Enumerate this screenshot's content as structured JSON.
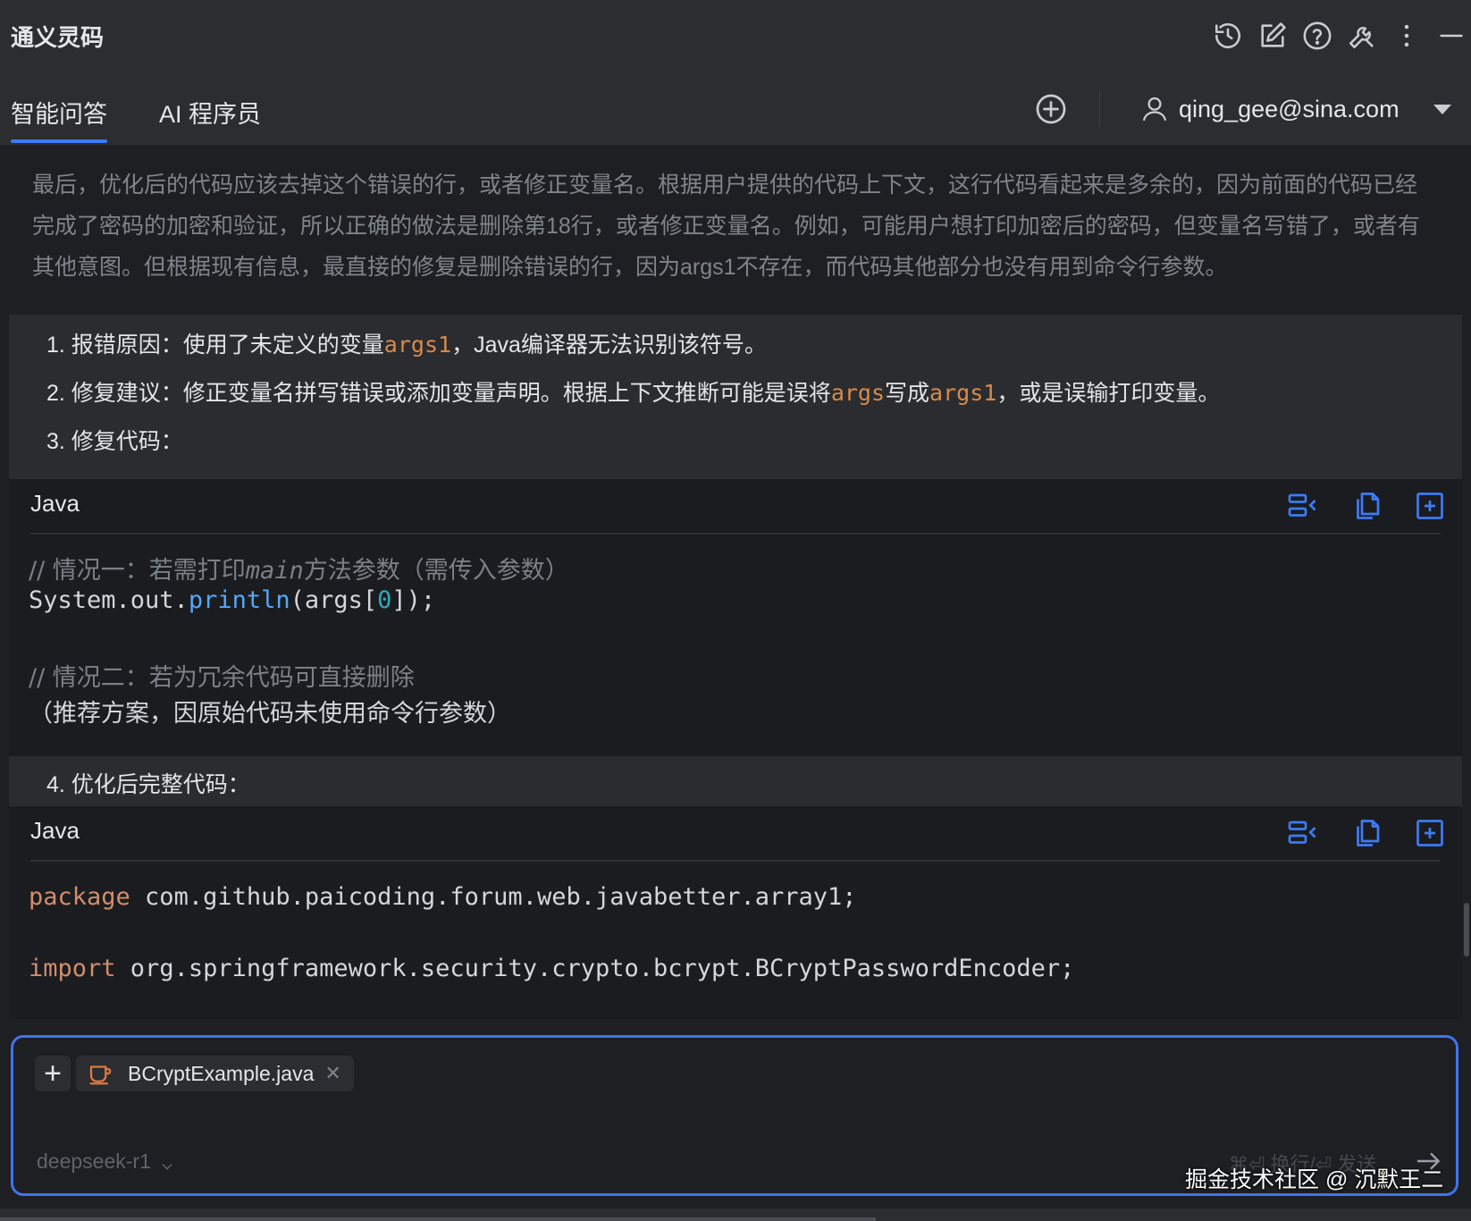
{
  "header": {
    "app_title": "通义灵码",
    "icons": [
      "history-icon",
      "edit-icon",
      "help-icon",
      "settings-wrench-icon",
      "more-vertical-icon",
      "minimize-icon"
    ]
  },
  "tabs": [
    {
      "label": "智能问答",
      "active": true
    },
    {
      "label": "AI 程序员",
      "active": false
    }
  ],
  "user": {
    "email": "qing_gee@sina.com"
  },
  "chat": {
    "reasoning_text": "最后，优化后的代码应该去掉这个错误的行，或者修正变量名。根据用户提供的代码上下文，这行代码看起来是多余的，因为前面的代码已经完成了密码的加密和验证，所以正确的做法是删除第18行，或者修正变量名。例如，可能用户想打印加密后的密码，但变量名写错了，或者有其他意图。但根据现有信息，最直接的修复是删除错误的行，因为args1不存在，而代码其他部分也没有用到命令行参数。",
    "item1": {
      "prefix": "1. 报错原因：使用了未定义的变量",
      "code": "args1",
      "suffix": "，Java编译器无法识别该符号。"
    },
    "item2": {
      "prefix": "2. 修复建议：修正变量名拼写错误或添加变量声明。根据上下文推断可能是误将",
      "code1": "args",
      "mid": "写成",
      "code2": "args1",
      "suffix": "，或是误输打印变量。"
    },
    "item3": "3. 修复代码：",
    "item4": "4. 优化后完整代码：",
    "code1": {
      "lang": "Java",
      "comment1_prefix": "// 情况一：若需打印",
      "comment1_italic": "main",
      "comment1_suffix": "方法参数（需传入参数）",
      "line2_obj": "System.out.",
      "line2_fn": "println",
      "line2_open": "(args[",
      "line2_num": "0",
      "line2_close": "]);",
      "comment2": "// 情况二：若为冗余代码可直接删除",
      "line5": "（推荐方案，因原始代码未使用命令行参数）"
    },
    "code2": {
      "lang": "Java",
      "kw_package": "package",
      "package_name": " com.github.paicoding.forum.web.javabetter.array1;",
      "kw_import": "import",
      "import_name": " org.springframework.security.crypto.bcrypt.BCryptPasswordEncoder;"
    },
    "code_actions": [
      "insert-icon",
      "copy-icon",
      "new-file-icon"
    ]
  },
  "input": {
    "context_file": "BCryptExample.java",
    "model": "deepseek-r1",
    "send_hint": "⌘⏎ 换行/⏎ 发送"
  },
  "watermark": "掘金技术社区 @ 沉默王二",
  "colors": {
    "accent": "#3d7bf5",
    "highlight": "#d98a4a"
  }
}
